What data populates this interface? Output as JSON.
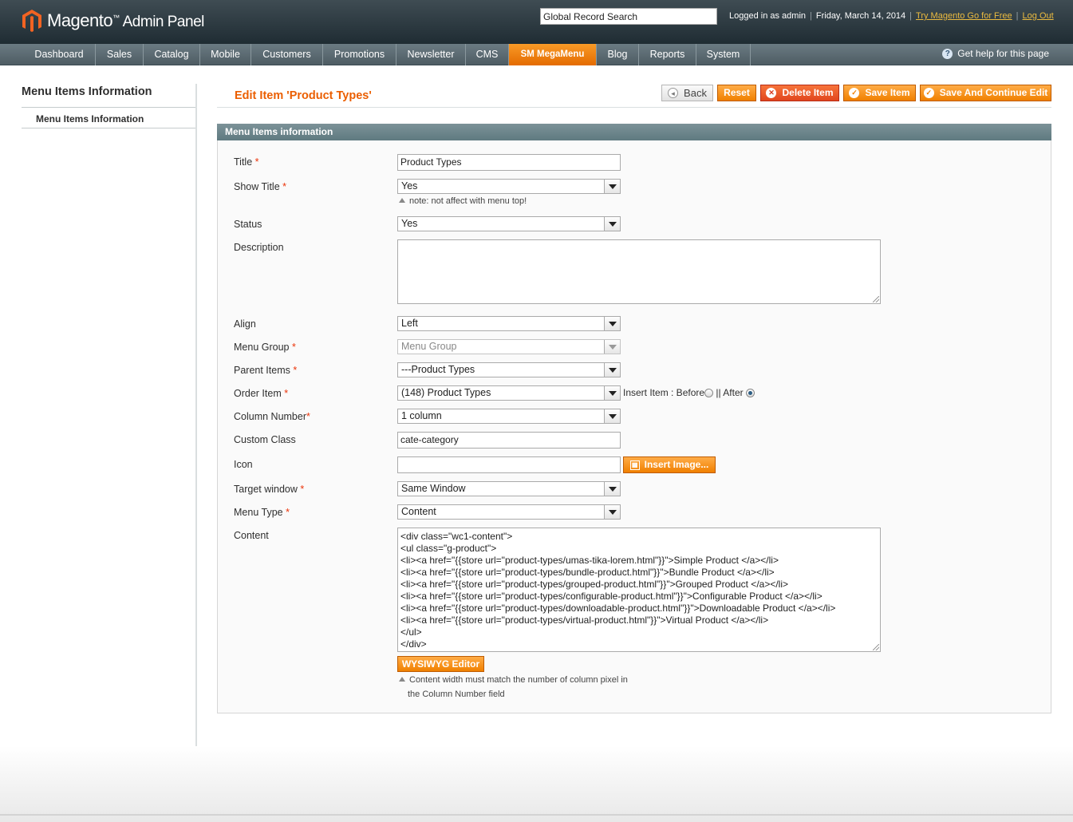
{
  "header": {
    "brand": "Magento",
    "brand_suffix": "Admin Panel",
    "search_value": "Global Record Search",
    "logged_in": "Logged in as admin",
    "date": "Friday, March 14, 2014",
    "try_link": "Try Magento Go for Free",
    "logout": "Log Out"
  },
  "nav": {
    "items": [
      "Dashboard",
      "Sales",
      "Catalog",
      "Mobile",
      "Customers",
      "Promotions",
      "Newsletter",
      "CMS",
      "SM MegaMenu",
      "Blog",
      "Reports",
      "System"
    ],
    "help": "Get help for this page"
  },
  "sidebar": {
    "title": "Menu Items Information",
    "item": "Menu Items Information"
  },
  "page": {
    "title": "Edit Item 'Product Types'",
    "buttons": {
      "back": "Back",
      "reset": "Reset",
      "delete": "Delete Item",
      "save": "Save Item",
      "save_continue": "Save And Continue Edit"
    },
    "section": "Menu Items information"
  },
  "form": {
    "title_label": "Title",
    "title_value": "Product Types",
    "show_title_label": "Show Title",
    "show_title_value": "Yes",
    "show_title_note": "note: not affect with menu top!",
    "status_label": "Status",
    "status_value": "Yes",
    "description_label": "Description",
    "align_label": "Align",
    "align_value": "Left",
    "menu_group_label": "Menu Group",
    "menu_group_value": "Menu Group",
    "parent_label": "Parent Items",
    "parent_value": "---Product Types",
    "order_label": "Order Item",
    "order_value": "(148) Product Types",
    "insert_text": "Insert Item : Before",
    "insert_sep": "||",
    "insert_after": "After",
    "column_label": "Column Number",
    "column_value": "1 column",
    "custom_class_label": "Custom Class",
    "custom_class_value": "cate-category",
    "icon_label": "Icon",
    "insert_image": "Insert Image...",
    "target_label": "Target window",
    "target_value": "Same Window",
    "menu_type_label": "Menu Type",
    "menu_type_value": "Content",
    "content_label": "Content",
    "content_lines": [
      "<div class=\"wc1-content\">",
      "<ul class=\"g-product\">",
      "<li><a href=\"{{store url=\"product-types/umas-tika-lorem.html\"}}\">Simple Product </a></li>",
      "<li><a href=\"{{store url=\"product-types/bundle-product.html\"}}\">Bundle Product </a></li>",
      "<li><a href=\"{{store url=\"product-types/grouped-product.html\"}}\">Grouped Product </a></li>",
      "<li><a href=\"{{store url=\"product-types/configurable-product.html\"}}\">Configurable Product </a></li>",
      "<li><a href=\"{{store url=\"product-types/downloadable-product.html\"}}\">Downloadable Product </a></li>",
      "<li><a href=\"{{store url=\"product-types/virtual-product.html\"}}\">Virtual Product </a></li>",
      "</ul>",
      "</div>"
    ],
    "wysiwyg": "WYSIWYG Editor",
    "content_note_1": "Content width must match the number of column pixel in",
    "content_note_2": "the Column Number field",
    "required_mark": "*"
  },
  "colors": {
    "accent_orange": "#eb5e00",
    "header_dark": "#1f2c33",
    "section_head": "#6b858b"
  }
}
